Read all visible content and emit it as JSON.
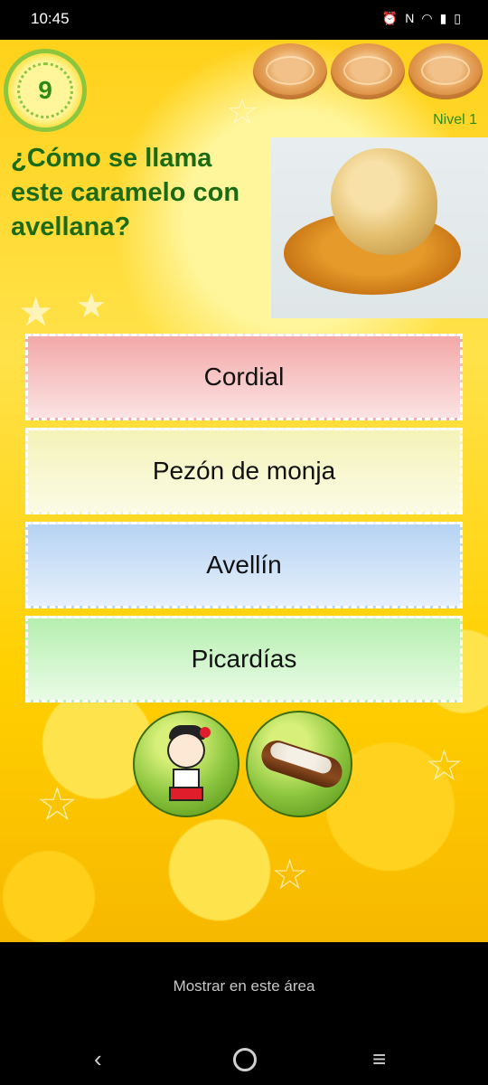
{
  "status_bar": {
    "time": "10:45",
    "icons": [
      "alarm-icon",
      "nfc-icon",
      "wifi-icon",
      "signal-icon",
      "battery-icon"
    ]
  },
  "game": {
    "timer": "9",
    "level": "Nivel 1",
    "lives": 3,
    "question": "¿Cómo se llama este caramelo con avellana?",
    "answers": [
      "Cordial",
      "Pezón de monja",
      "Avellín",
      "Picardías"
    ],
    "helpers": [
      "character-helper-icon",
      "pastry-helper-icon"
    ]
  },
  "ad": {
    "label": "Mostrar en este área"
  },
  "nav": {
    "back": "‹",
    "menu": "≡"
  },
  "colors": {
    "question_text": "#1a6b14",
    "accent_green": "#8cc63f"
  }
}
